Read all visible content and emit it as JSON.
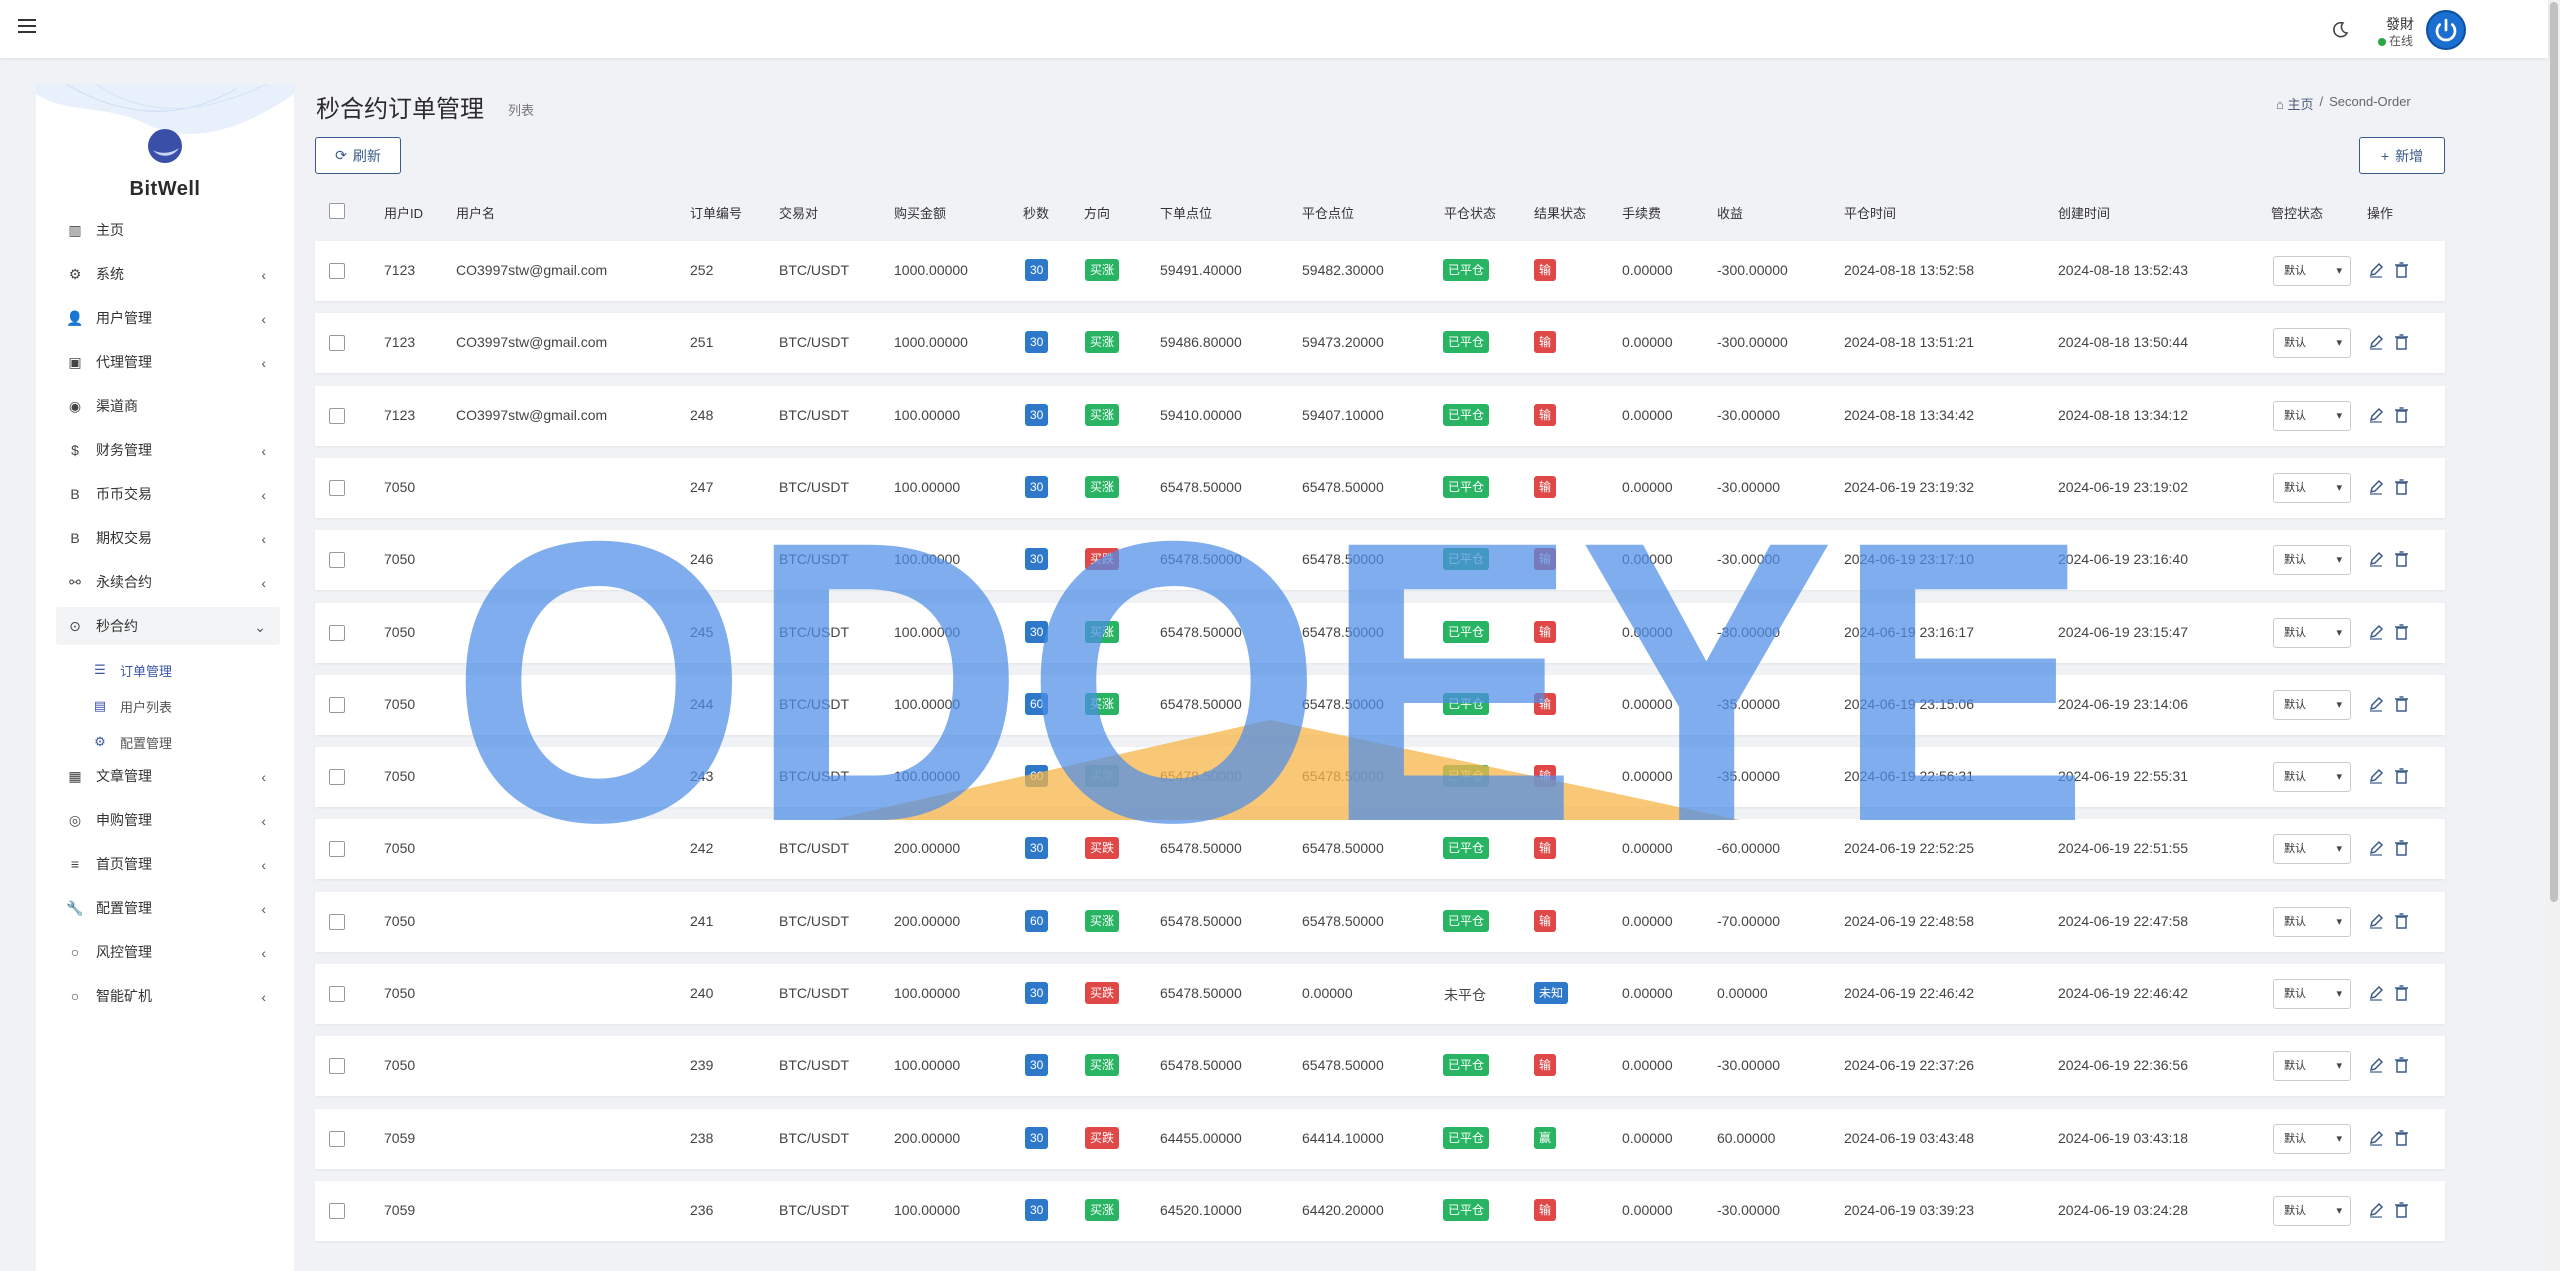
{
  "header": {
    "user_name": "發財",
    "user_status": "在线"
  },
  "brand": "BitWell",
  "sidebar": {
    "items": [
      {
        "label": "主页",
        "icon": "chart-bar-icon",
        "has_sub": false
      },
      {
        "label": "系统",
        "icon": "gear-icon",
        "has_sub": true
      },
      {
        "label": "用户管理",
        "icon": "user-icon",
        "has_sub": true
      },
      {
        "label": "代理管理",
        "icon": "id-card-icon",
        "has_sub": true
      },
      {
        "label": "渠道商",
        "icon": "user-circle-icon",
        "has_sub": false
      },
      {
        "label": "财务管理",
        "icon": "dollar-icon",
        "has_sub": true
      },
      {
        "label": "币币交易",
        "icon": "bitcoin-icon",
        "has_sub": true
      },
      {
        "label": "期权交易",
        "icon": "bitcoin-icon",
        "has_sub": true
      },
      {
        "label": "永续合约",
        "icon": "link-icon",
        "has_sub": true
      },
      {
        "label": "秒合约",
        "icon": "dot-circle-icon",
        "has_sub": true,
        "expanded": true
      }
    ],
    "sub_items": [
      {
        "label": "订单管理",
        "icon": "list-icon",
        "active": true
      },
      {
        "label": "用户列表",
        "icon": "contact-icon",
        "active": false
      },
      {
        "label": "配置管理",
        "icon": "gear-icon",
        "active": false
      }
    ],
    "items_after": [
      {
        "label": "文章管理",
        "icon": "newspaper-icon",
        "has_sub": true
      },
      {
        "label": "申购管理",
        "icon": "life-ring-icon",
        "has_sub": true
      },
      {
        "label": "首页管理",
        "icon": "bars-icon",
        "has_sub": true
      },
      {
        "label": "配置管理",
        "icon": "wrench-icon",
        "has_sub": true
      },
      {
        "label": "风控管理",
        "icon": "circle-icon",
        "has_sub": true
      },
      {
        "label": "智能矿机",
        "icon": "circle-icon",
        "has_sub": true
      }
    ]
  },
  "page": {
    "title": "秒合约订单管理",
    "subtitle": "列表",
    "breadcrumb": [
      "主页",
      "Second-Order"
    ],
    "refresh_label": "刷新",
    "add_label": "新增"
  },
  "table": {
    "columns": [
      "用户ID",
      "用户名",
      "订单编号",
      "交易对",
      "购买金额",
      "秒数",
      "方向",
      "下单点位",
      "平仓点位",
      "平仓状态",
      "结果状态",
      "手续费",
      "收益",
      "平仓时间",
      "创建时间",
      "管控状态",
      "操作"
    ],
    "control_default": "默认",
    "rows": [
      {
        "uid": "7123",
        "name": "CO3997stw@gmail.com",
        "order": "252",
        "pair": "BTC/USDT",
        "amount": "1000.00000",
        "secs": "30",
        "dir": "买涨",
        "open": "59491.40000",
        "close": "59482.30000",
        "close_status": "已平仓",
        "result": "输",
        "fee": "0.00000",
        "profit": "-300.00000",
        "close_time": "2024-08-18 13:52:58",
        "create_time": "2024-08-18 13:52:43"
      },
      {
        "uid": "7123",
        "name": "CO3997stw@gmail.com",
        "order": "251",
        "pair": "BTC/USDT",
        "amount": "1000.00000",
        "secs": "30",
        "dir": "买涨",
        "open": "59486.80000",
        "close": "59473.20000",
        "close_status": "已平仓",
        "result": "输",
        "fee": "0.00000",
        "profit": "-300.00000",
        "close_time": "2024-08-18 13:51:21",
        "create_time": "2024-08-18 13:50:44"
      },
      {
        "uid": "7123",
        "name": "CO3997stw@gmail.com",
        "order": "248",
        "pair": "BTC/USDT",
        "amount": "100.00000",
        "secs": "30",
        "dir": "买涨",
        "open": "59410.00000",
        "close": "59407.10000",
        "close_status": "已平仓",
        "result": "输",
        "fee": "0.00000",
        "profit": "-30.00000",
        "close_time": "2024-08-18 13:34:42",
        "create_time": "2024-08-18 13:34:12"
      },
      {
        "uid": "7050",
        "name": "",
        "order": "247",
        "pair": "BTC/USDT",
        "amount": "100.00000",
        "secs": "30",
        "dir": "买涨",
        "open": "65478.50000",
        "close": "65478.50000",
        "close_status": "已平仓",
        "result": "输",
        "fee": "0.00000",
        "profit": "-30.00000",
        "close_time": "2024-06-19 23:19:32",
        "create_time": "2024-06-19 23:19:02"
      },
      {
        "uid": "7050",
        "name": "",
        "order": "246",
        "pair": "BTC/USDT",
        "amount": "100.00000",
        "secs": "30",
        "dir": "买跌",
        "open": "65478.50000",
        "close": "65478.50000",
        "close_status": "已平仓",
        "result": "输",
        "fee": "0.00000",
        "profit": "-30.00000",
        "close_time": "2024-06-19 23:17:10",
        "create_time": "2024-06-19 23:16:40"
      },
      {
        "uid": "7050",
        "name": "",
        "order": "245",
        "pair": "BTC/USDT",
        "amount": "100.00000",
        "secs": "30",
        "dir": "买涨",
        "open": "65478.50000",
        "close": "65478.50000",
        "close_status": "已平仓",
        "result": "输",
        "fee": "0.00000",
        "profit": "-30.00000",
        "close_time": "2024-06-19 23:16:17",
        "create_time": "2024-06-19 23:15:47"
      },
      {
        "uid": "7050",
        "name": "",
        "order": "244",
        "pair": "BTC/USDT",
        "amount": "100.00000",
        "secs": "60",
        "dir": "买涨",
        "open": "65478.50000",
        "close": "65478.50000",
        "close_status": "已平仓",
        "result": "输",
        "fee": "0.00000",
        "profit": "-35.00000",
        "close_time": "2024-06-19 23:15:06",
        "create_time": "2024-06-19 23:14:06"
      },
      {
        "uid": "7050",
        "name": "",
        "order": "243",
        "pair": "BTC/USDT",
        "amount": "100.00000",
        "secs": "60",
        "dir": "买涨",
        "open": "65478.50000",
        "close": "65478.50000",
        "close_status": "已平仓",
        "result": "输",
        "fee": "0.00000",
        "profit": "-35.00000",
        "close_time": "2024-06-19 22:56:31",
        "create_time": "2024-06-19 22:55:31"
      },
      {
        "uid": "7050",
        "name": "",
        "order": "242",
        "pair": "BTC/USDT",
        "amount": "200.00000",
        "secs": "30",
        "dir": "买跌",
        "open": "65478.50000",
        "close": "65478.50000",
        "close_status": "已平仓",
        "result": "输",
        "fee": "0.00000",
        "profit": "-60.00000",
        "close_time": "2024-06-19 22:52:25",
        "create_time": "2024-06-19 22:51:55"
      },
      {
        "uid": "7050",
        "name": "",
        "order": "241",
        "pair": "BTC/USDT",
        "amount": "200.00000",
        "secs": "60",
        "dir": "买涨",
        "open": "65478.50000",
        "close": "65478.50000",
        "close_status": "已平仓",
        "result": "输",
        "fee": "0.00000",
        "profit": "-70.00000",
        "close_time": "2024-06-19 22:48:58",
        "create_time": "2024-06-19 22:47:58"
      },
      {
        "uid": "7050",
        "name": "",
        "order": "240",
        "pair": "BTC/USDT",
        "amount": "100.00000",
        "secs": "30",
        "dir": "买跌",
        "open": "65478.50000",
        "close": "0.00000",
        "close_status": "未平仓",
        "result": "未知",
        "fee": "0.00000",
        "profit": "0.00000",
        "close_time": "2024-06-19 22:46:42",
        "create_time": "2024-06-19 22:46:42"
      },
      {
        "uid": "7050",
        "name": "",
        "order": "239",
        "pair": "BTC/USDT",
        "amount": "100.00000",
        "secs": "30",
        "dir": "买涨",
        "open": "65478.50000",
        "close": "65478.50000",
        "close_status": "已平仓",
        "result": "输",
        "fee": "0.00000",
        "profit": "-30.00000",
        "close_time": "2024-06-19 22:37:26",
        "create_time": "2024-06-19 22:36:56"
      },
      {
        "uid": "7059",
        "name": "",
        "order": "238",
        "pair": "BTC/USDT",
        "amount": "200.00000",
        "secs": "30",
        "dir": "买跌",
        "open": "64455.00000",
        "close": "64414.10000",
        "close_status": "已平仓",
        "result": "赢",
        "fee": "0.00000",
        "profit": "60.00000",
        "close_time": "2024-06-19 03:43:48",
        "create_time": "2024-06-19 03:43:18"
      },
      {
        "uid": "7059",
        "name": "",
        "order": "236",
        "pair": "BTC/USDT",
        "amount": "100.00000",
        "secs": "30",
        "dir": "买涨",
        "open": "64520.10000",
        "close": "64420.20000",
        "close_status": "已平仓",
        "result": "输",
        "fee": "0.00000",
        "profit": "-30.00000",
        "close_time": "2024-06-19 03:39:23",
        "create_time": "2024-06-19 03:24:28"
      }
    ]
  },
  "watermark": "ODOEYE",
  "colors": {
    "primary": "#3a5a8a",
    "secs_badge": "#2d78c8",
    "up_badge": "#28b463",
    "down_badge": "#e04848",
    "closed_badge": "#28b463",
    "lose_badge": "#e04848",
    "win_badge": "#28b463",
    "unknown_badge": "#2d78c8",
    "watermark": "#4d8ee8"
  }
}
